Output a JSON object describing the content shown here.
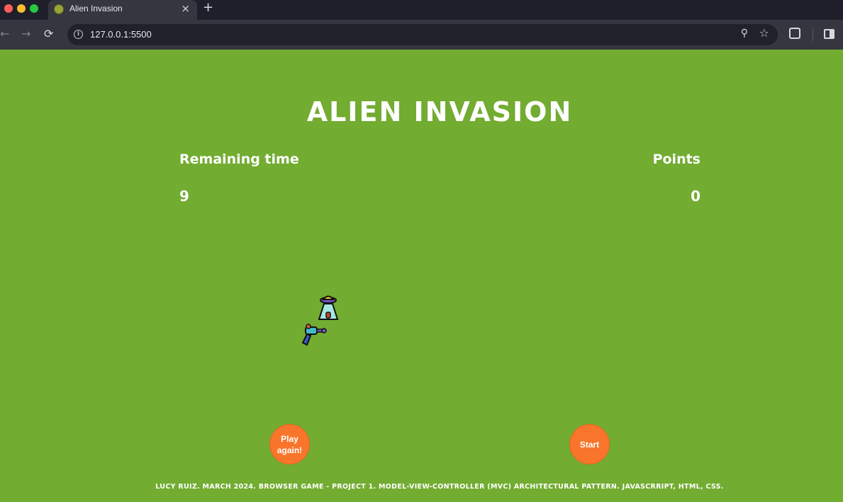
{
  "browser": {
    "tab_title": "Alien Invasion",
    "tab_close": "×",
    "new_tab": "+",
    "url": "127.0.0.1:5500",
    "icons": {
      "back": "←",
      "forward": "→",
      "reload": "⟳",
      "info": "i",
      "zoom": "⚲",
      "bookmark": "☆"
    }
  },
  "game": {
    "title": "ALIEN INVASION",
    "remaining_time_label": "Remaining time",
    "remaining_time_value": "9",
    "points_label": "Points",
    "points_value": "0",
    "play_again_label": "Play again!",
    "start_label": "Start",
    "footer": "LUCY RUIZ. MARCH 2024. BROWSER GAME - PROJECT 1. MODEL-VIEW-CONTROLLER (MVC) ARCHITECTURAL PATTERN. JAVASCRRIPT, HTML, CSS."
  },
  "colors": {
    "background": "#72ac31",
    "button": "#f8752b",
    "text": "#ffffff"
  }
}
